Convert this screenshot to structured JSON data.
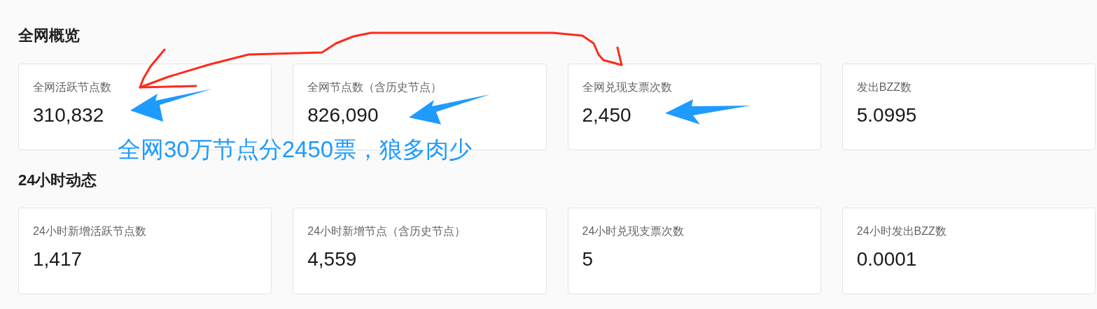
{
  "sections": [
    {
      "title": "全网概览",
      "cards": [
        {
          "label": "全网活跃节点数",
          "value": "310,832"
        },
        {
          "label": "全网节点数（含历史节点）",
          "value": "826,090"
        },
        {
          "label": "全网兑现支票次数",
          "value": "2,450"
        },
        {
          "label": "发出BZZ数",
          "value": "5.0995"
        }
      ]
    },
    {
      "title": "24小时动态",
      "cards": [
        {
          "label": "24小时新增活跃节点数",
          "value": "1,417"
        },
        {
          "label": "24小时新增节点（含历史节点）",
          "value": "4,559"
        },
        {
          "label": "24小时兑现支票次数",
          "value": "5"
        },
        {
          "label": "24小时发出BZZ数",
          "value": "0.0001"
        }
      ]
    }
  ],
  "annotation": {
    "text": "全网30万节点分2450票，狼多肉少"
  }
}
